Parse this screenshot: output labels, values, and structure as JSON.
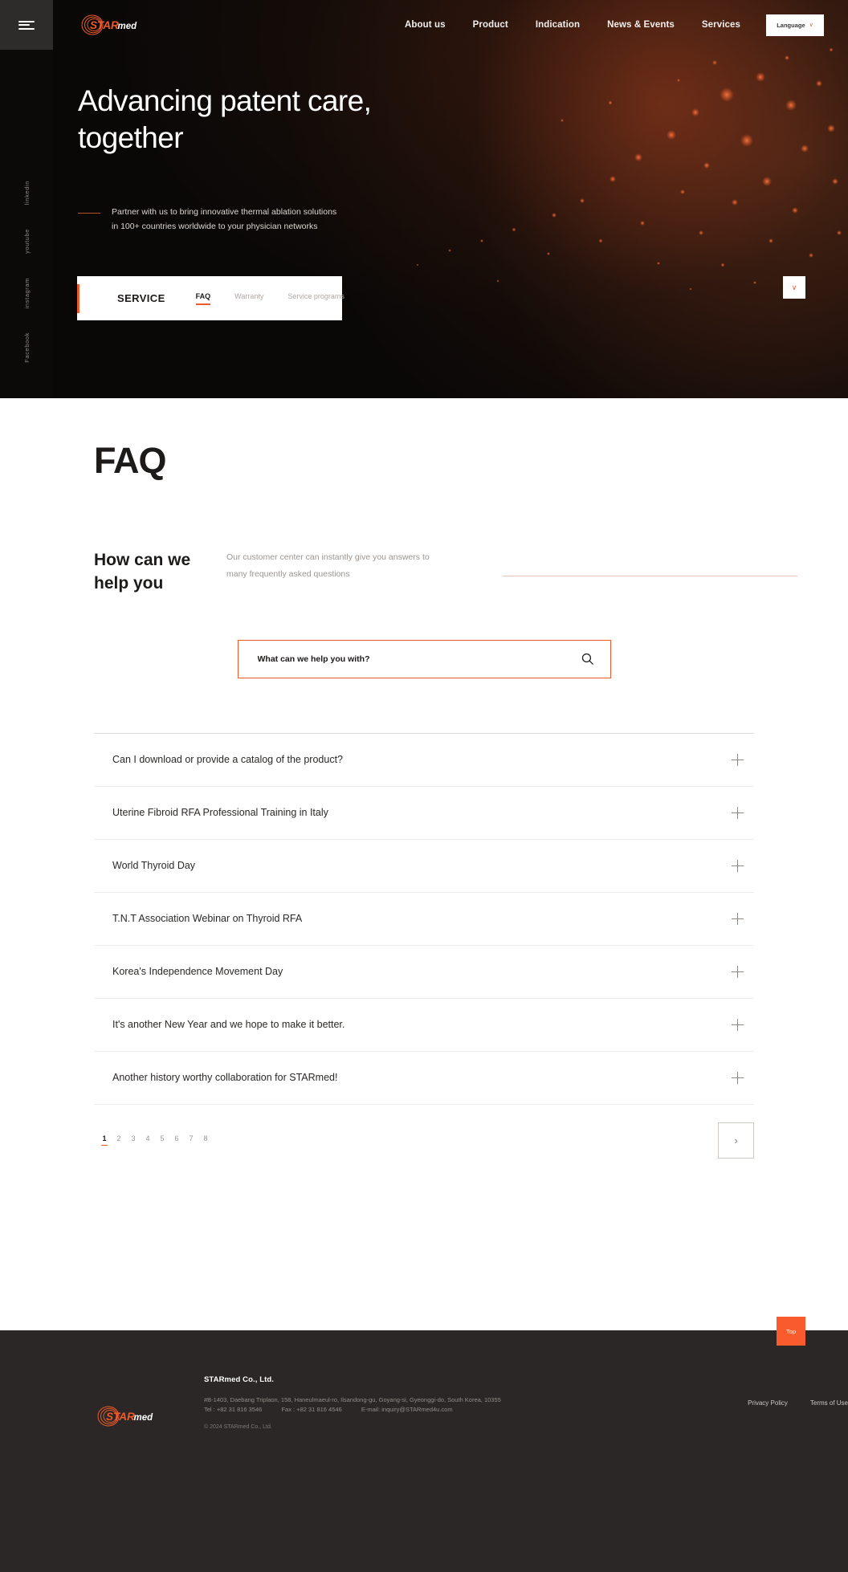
{
  "brand": {
    "name": "STARmed",
    "accent": "#ef5a2a",
    "footer_bg": "#2a2726"
  },
  "header": {
    "logo_alt": "STARmed",
    "nav": [
      {
        "label": "About us"
      },
      {
        "label": "Product"
      },
      {
        "label": "Indication"
      },
      {
        "label": "News & Events"
      },
      {
        "label": "Services"
      }
    ],
    "language": {
      "label": "Language",
      "chevron": "∨"
    }
  },
  "left_rail": {
    "socials": [
      {
        "label": "linkedin"
      },
      {
        "label": "youtube"
      },
      {
        "label": "instagram"
      },
      {
        "label": "Facebook"
      }
    ]
  },
  "hero": {
    "title_line1": "Advancing patent care,",
    "title_line2": "together",
    "subtitle_line1": "Partner with us to bring innovative thermal ablation solutions",
    "subtitle_line2": "in 100+ countries worldwide to your physician networks"
  },
  "service_bar": {
    "label": "SERVICE",
    "tabs": [
      {
        "label": "FAQ",
        "active": true
      },
      {
        "label": "Warranty",
        "active": false
      },
      {
        "label": "Service programs",
        "active": false
      }
    ],
    "dropdown_chevron": "∨"
  },
  "main": {
    "page_title": "FAQ",
    "help_title_line1": "How can we",
    "help_title_line2": "help you",
    "help_desc_line1": "Our customer center can instantly give you answers to",
    "help_desc_line2": "many frequently asked questions",
    "search": {
      "placeholder": "What can we help you with?",
      "value": "",
      "icon": "search-icon"
    },
    "faq_items": [
      {
        "question": "Can I download or provide a catalog of the product?"
      },
      {
        "question": "Uterine Fibroid RFA Professional Training in Italy"
      },
      {
        "question": "World Thyroid Day"
      },
      {
        "question": "T.N.T Association Webinar on Thyroid RFA"
      },
      {
        "question": "Korea's Independence Movement Day"
      },
      {
        "question": "It's another New Year and we hope to make it better."
      },
      {
        "question": " Another history worthy collaboration for STARmed!"
      }
    ],
    "pagination": {
      "pages": [
        "1",
        "2",
        "3",
        "4",
        "5",
        "6",
        "7",
        "8"
      ],
      "current": "1",
      "next_chevron": "›"
    }
  },
  "top_button": {
    "label": "Top"
  },
  "footer": {
    "logo_alt": "STARmed",
    "company": "STARmed Co., Ltd.",
    "address": "#B-1403, Daebang Triplaon, 158, Haneulmaeul-ro, Ilsandong-gu, Goyang-si, Gyeonggi-do, South Korea, 10355",
    "tel": "Tel : +82 31 816 3546",
    "fax": "Fax : +82 31 816 4546",
    "email": "E-mail: inquiry@STARmed4u.com",
    "copyright": "© 2024 STARmed Co., Ltd.",
    "links": [
      {
        "label": "Privacy Policy"
      },
      {
        "label": "Terms of Use"
      }
    ]
  }
}
